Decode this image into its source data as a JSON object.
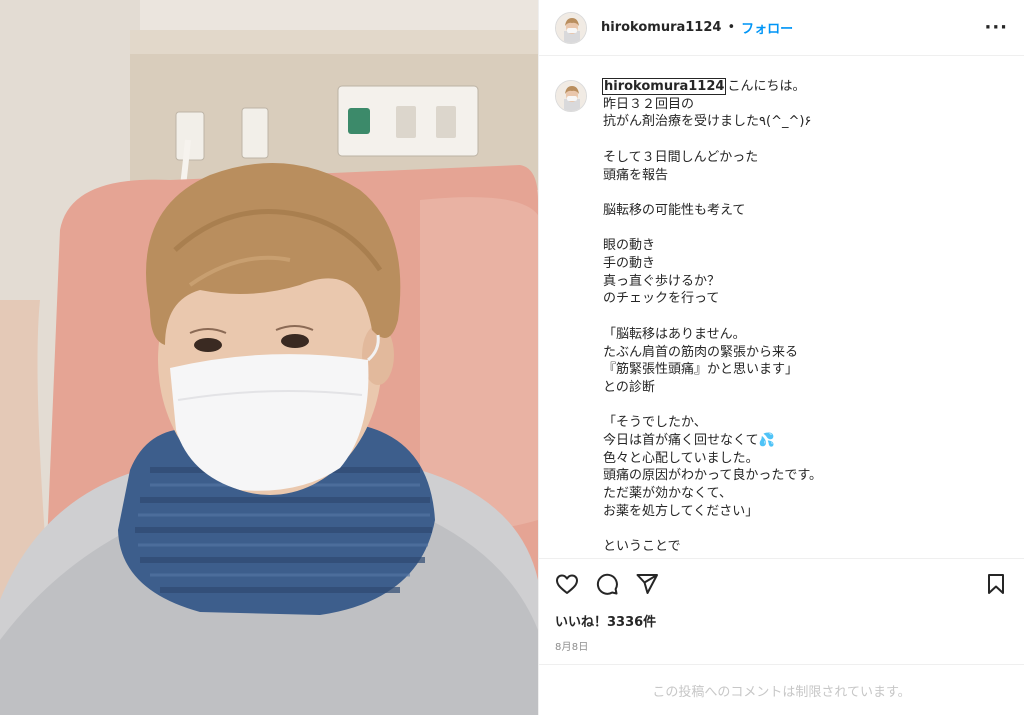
{
  "header": {
    "username": "hirokomura1124",
    "separator": "•",
    "follow_label": "フォロー",
    "more_icon": "more-horizontal-icon",
    "more_label": "···"
  },
  "caption": {
    "username": "hirokomura1124",
    "text": "こんにちは。\n昨日３２回目の\n抗がん剤治療を受けました٩(^_^)۶\n\nそして３日間しんどかった\n頭痛を報告\n\n脳転移の可能性も考えて\n\n眼の動き\n手の動き\n真っ直ぐ歩けるか？\nのチェックを行って\n\n「脳転移はありません。\nたぶん肩首の筋肉の緊張から来る\n『筋緊張性頭痛』かと思います」\nとの診断\n\n「そうでしたか、\n今日は首が痛く回せなくて💦\n色々と心配していました。\n頭痛の原因がわかって良かったです。\nただ薬が効かなくて、\nお薬を処方してください」\n\nということで\n"
  },
  "actions": {
    "like_icon": "heart-icon",
    "comment_icon": "comment-icon",
    "share_icon": "paper-plane-icon",
    "save_icon": "bookmark-icon"
  },
  "likes": "いいね！3336件",
  "date": "8月8日",
  "comment_notice": "この投稿へのコメントは制限されています。"
}
